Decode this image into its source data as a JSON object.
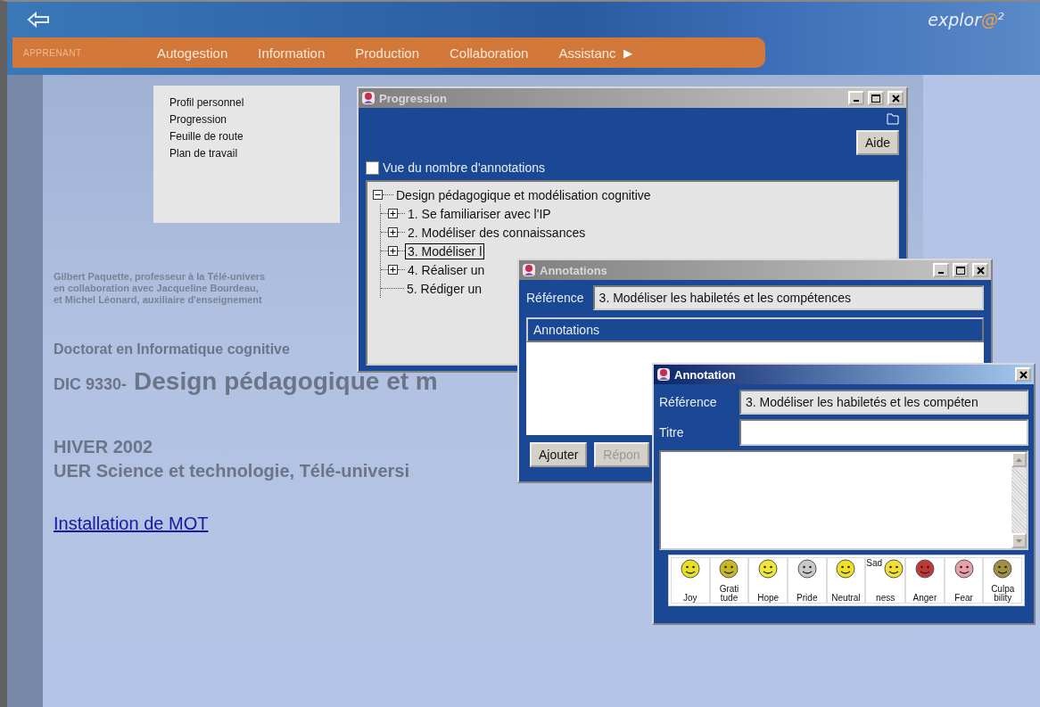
{
  "header": {
    "logo": {
      "text": "explor",
      "at": "@",
      "sup": "2"
    },
    "role": "APPRENANT",
    "nav": [
      "Autogestion",
      "Information",
      "Production",
      "Collaboration",
      "Assistanc"
    ],
    "nav_more": "▶"
  },
  "submenu": [
    "Profil personnel",
    "Progression",
    "Feuille de route",
    "Plan de travail"
  ],
  "credits": [
    "**Gilbert Paquette**, professeur à la Télé-univers",
    "en collaboration avec **Jacqueline Bourdeau**,",
    "et **Michel Léonard**, auxiliaire d'enseignement"
  ],
  "program": "Doctorat en Informatique cognitive",
  "course": {
    "code": "DIC 9330-",
    "title": "Design pédagogique et m"
  },
  "term": "HIVER 2002",
  "unit": "UER Science et technologie, Télé-universi",
  "link": "Installation de MOT",
  "progression_window": {
    "title": "Progression",
    "active": false,
    "help_button": "Aide",
    "checkbox": {
      "label": "Vue du nombre d'annotations",
      "checked": false
    },
    "tree": {
      "label": "Design pédagogique et modélisation cognitive",
      "expanded": true,
      "children": [
        {
          "label": "1. Se familiariser avec l'IP",
          "expandable": true,
          "selected": false
        },
        {
          "label": "2. Modéliser des connaissances",
          "expandable": true,
          "selected": false
        },
        {
          "label": "3. Modéliser l",
          "expandable": true,
          "selected": true
        },
        {
          "label": "4. Réaliser un",
          "expandable": true,
          "selected": false
        },
        {
          "label": "5. Rédiger un",
          "expandable": false,
          "selected": false
        }
      ]
    }
  },
  "annotations_window": {
    "title": "Annotations",
    "active": false,
    "reference_label": "Référence",
    "reference": "3. Modéliser les habiletés et les compétences",
    "list_header": "Annotations",
    "buttons": [
      {
        "label": "Ajouter",
        "disabled": false
      },
      {
        "label": "Répon",
        "disabled": true
      }
    ]
  },
  "annotation_window": {
    "title": "Annotation",
    "active": true,
    "reference_label": "Référence",
    "reference": "3. Modéliser les habiletés et les compéten",
    "title_label": "Titre",
    "emotions": [
      {
        "label": "Joy",
        "color": "#e8e020"
      },
      {
        "label": "Grati\ntude",
        "color": "#c8b820"
      },
      {
        "label": "Hope",
        "color": "#f0e830"
      },
      {
        "label": "Pride",
        "color": "#c8c8c8"
      },
      {
        "label": "Neutral",
        "color": "#f0e020"
      },
      {
        "top": "Sad",
        "label": "ness",
        "color": "#f0e030"
      },
      {
        "label": "Anger",
        "color": "#c03838"
      },
      {
        "label": "Fear",
        "color": "#e8a0a8"
      },
      {
        "label": "Culpa\nbility",
        "color": "#a09040"
      }
    ]
  }
}
